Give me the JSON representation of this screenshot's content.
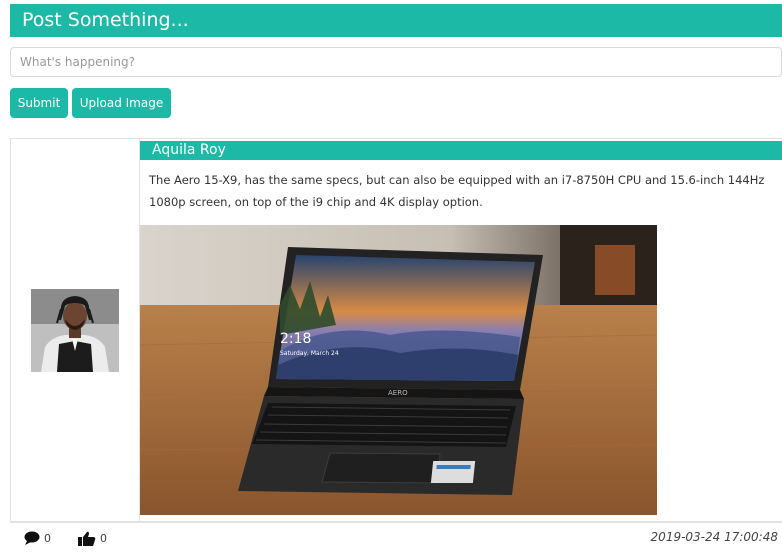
{
  "compose": {
    "header_title": "Post Something...",
    "input_placeholder": "What's happening?",
    "submit_label": "Submit",
    "upload_label": "Upload Image"
  },
  "post": {
    "author": "Aquila Roy",
    "text": "The Aero 15-X9, has the same specs, but can also be equipped with an i7-8750H CPU and 15.6-inch 144Hz 1080p screen, on top of the i9 chip and 4K display option.",
    "image_screen_time": "2:18",
    "image_screen_date": "Saturday, March 24",
    "image_brand": "AERO",
    "comment_count": "0",
    "like_count": "0",
    "timestamp": "2019-03-24 17:00:48"
  },
  "icons": {
    "comment": "comment-icon",
    "like": "thumbs-up-icon"
  },
  "colors": {
    "accent": "#1bb9a6",
    "text": "#333333",
    "border": "#e2e2e2"
  }
}
